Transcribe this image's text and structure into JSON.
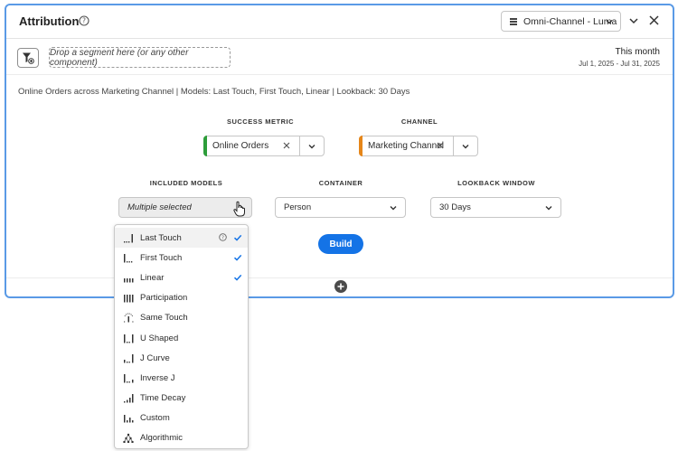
{
  "panel": {
    "title": "Attribution",
    "report_suite": "Omni-Channel - Luma",
    "drop_zone": "Drop a segment here (or any other component)",
    "date_title": "This month",
    "date_range": "Jul 1, 2025 - Jul 31, 2025",
    "summary": "Online Orders across Marketing Channel | Models: Last Touch, First Touch, Linear | Lookback: 30 Days"
  },
  "success_metric": {
    "label": "SUCCESS METRIC",
    "value": "Online Orders",
    "color": "#2d9d3a"
  },
  "channel": {
    "label": "CHANNEL",
    "value": "Marketing Channel",
    "color": "#e68619"
  },
  "included_models": {
    "label": "INCLUDED MODELS",
    "value": "Multiple selected"
  },
  "container": {
    "label": "CONTAINER",
    "value": "Person"
  },
  "lookback": {
    "label": "LOOKBACK WINDOW",
    "value": "30 Days"
  },
  "build_label": "Build",
  "accent_color": "#1473e6",
  "models_menu": [
    {
      "label": "Last Touch",
      "icon": "last-touch-icon",
      "checked": true,
      "info": true,
      "highlighted": true
    },
    {
      "label": "First Touch",
      "icon": "first-touch-icon",
      "checked": true
    },
    {
      "label": "Linear",
      "icon": "linear-icon",
      "checked": true
    },
    {
      "label": "Participation",
      "icon": "participation-icon",
      "checked": false
    },
    {
      "label": "Same Touch",
      "icon": "same-touch-icon",
      "checked": false
    },
    {
      "label": "U Shaped",
      "icon": "u-shaped-icon",
      "checked": false
    },
    {
      "label": "J Curve",
      "icon": "j-curve-icon",
      "checked": false
    },
    {
      "label": "Inverse J",
      "icon": "inverse-j-icon",
      "checked": false
    },
    {
      "label": "Time Decay",
      "icon": "time-decay-icon",
      "checked": false
    },
    {
      "label": "Custom",
      "icon": "custom-icon",
      "checked": false
    },
    {
      "label": "Algorithmic",
      "icon": "algorithmic-icon",
      "checked": false
    }
  ]
}
